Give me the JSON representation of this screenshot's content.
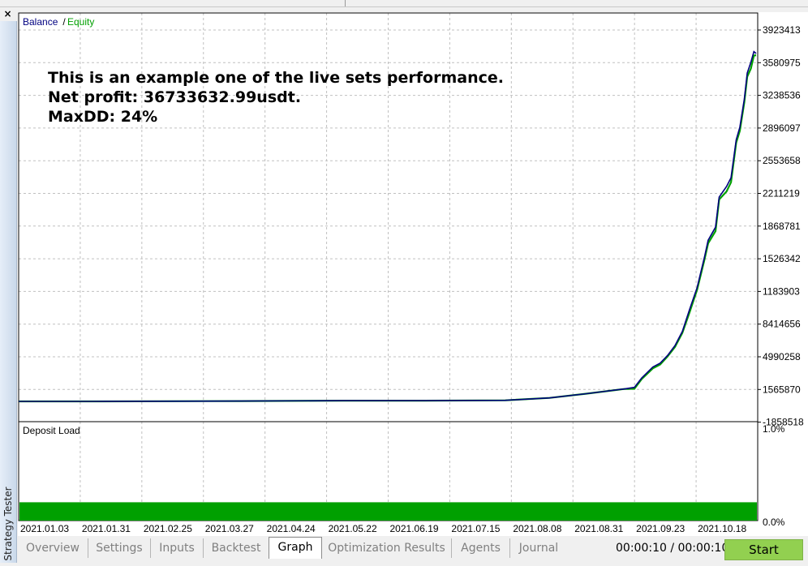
{
  "window": {
    "close_label": "×",
    "side_tab_label": "Strategy Tester"
  },
  "chart_data": {
    "type": "line",
    "legend": [
      {
        "label": "Balance",
        "color": "#000080"
      },
      {
        "label": "Equity",
        "color": "#00a000"
      }
    ],
    "legend_separator": " / ",
    "annotation": [
      "This is an example one of the live sets performance.",
      "Net profit: 36733632.99usdt.",
      "MaxDD: 24%"
    ],
    "y_tick_labels": [
      "3923413",
      "3580975",
      "3238536",
      "2896097",
      "2553658",
      "2211219",
      "1868781",
      "1526342",
      "1183903",
      "8414656",
      "4990258",
      "1565870",
      "-1858518"
    ],
    "x_tick_labels": [
      "2021.01.03",
      "2021.01.31",
      "2021.02.25",
      "2021.03.27",
      "2021.04.24",
      "2021.05.22",
      "2021.06.19",
      "2021.07.15",
      "2021.08.08",
      "2021.08.31",
      "2021.09.23",
      "2021.10.18"
    ],
    "x_range": [
      0,
      1
    ],
    "balance_series": [
      [
        0.0,
        0.0
      ],
      [
        0.1,
        0.0
      ],
      [
        0.3,
        0.001
      ],
      [
        0.44,
        0.002
      ],
      [
        0.55,
        0.002
      ],
      [
        0.66,
        0.003
      ],
      [
        0.72,
        0.01
      ],
      [
        0.77,
        0.022
      ],
      [
        0.82,
        0.035
      ],
      [
        0.835,
        0.04
      ],
      [
        0.845,
        0.067
      ],
      [
        0.86,
        0.098
      ],
      [
        0.87,
        0.109
      ],
      [
        0.88,
        0.131
      ],
      [
        0.89,
        0.159
      ],
      [
        0.9,
        0.199
      ],
      [
        0.91,
        0.263
      ],
      [
        0.92,
        0.324
      ],
      [
        0.93,
        0.411
      ],
      [
        0.935,
        0.459
      ],
      [
        0.945,
        0.496
      ],
      [
        0.95,
        0.582
      ],
      [
        0.96,
        0.612
      ],
      [
        0.966,
        0.637
      ],
      [
        0.973,
        0.745
      ],
      [
        0.978,
        0.781
      ],
      [
        0.984,
        0.861
      ],
      [
        0.988,
        0.935
      ],
      [
        0.993,
        0.966
      ],
      [
        0.997,
        0.996
      ],
      [
        1.0,
        0.991
      ]
    ],
    "equity_series": [
      [
        0.0,
        0.0
      ],
      [
        0.1,
        0.0
      ],
      [
        0.3,
        0.001
      ],
      [
        0.44,
        0.002
      ],
      [
        0.55,
        0.002
      ],
      [
        0.66,
        0.003
      ],
      [
        0.72,
        0.01
      ],
      [
        0.77,
        0.022
      ],
      [
        0.82,
        0.035
      ],
      [
        0.835,
        0.036
      ],
      [
        0.845,
        0.064
      ],
      [
        0.86,
        0.094
      ],
      [
        0.87,
        0.105
      ],
      [
        0.88,
        0.128
      ],
      [
        0.89,
        0.155
      ],
      [
        0.9,
        0.195
      ],
      [
        0.91,
        0.255
      ],
      [
        0.92,
        0.318
      ],
      [
        0.93,
        0.404
      ],
      [
        0.935,
        0.45
      ],
      [
        0.945,
        0.485
      ],
      [
        0.95,
        0.575
      ],
      [
        0.96,
        0.598
      ],
      [
        0.966,
        0.624
      ],
      [
        0.973,
        0.737
      ],
      [
        0.978,
        0.771
      ],
      [
        0.984,
        0.852
      ],
      [
        0.988,
        0.925
      ],
      [
        0.993,
        0.948
      ],
      [
        0.997,
        0.985
      ],
      [
        1.0,
        0.986
      ]
    ],
    "deposit_load": {
      "title": "Deposit Load",
      "y_tick_labels": [
        "1.0%",
        "0.0%"
      ],
      "load_fraction": 0.2,
      "bar_color": "#00a000"
    },
    "grid": true
  },
  "tabs": [
    {
      "label": "Overview",
      "active": false
    },
    {
      "label": "Settings",
      "active": false
    },
    {
      "label": "Inputs",
      "active": false
    },
    {
      "label": "Backtest",
      "active": false
    },
    {
      "label": "Graph",
      "active": true
    },
    {
      "label": "Optimization Results",
      "active": false
    },
    {
      "label": "Agents",
      "active": false
    },
    {
      "label": "Journal",
      "active": false
    }
  ],
  "status": {
    "timer": "00:00:10 / 00:00:10"
  },
  "start_button": {
    "label": "Start",
    "color": "#92d050"
  }
}
